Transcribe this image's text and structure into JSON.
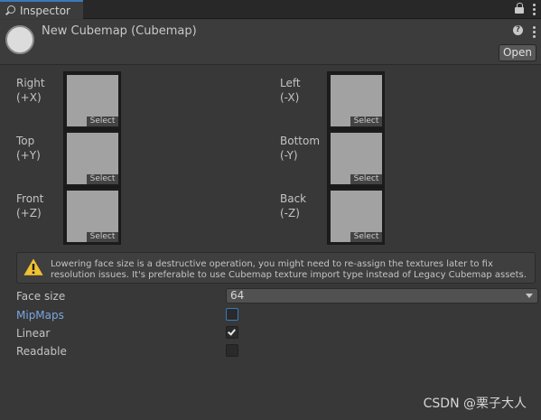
{
  "tab": {
    "label": "Inspector",
    "icon": "search-icon"
  },
  "header": {
    "title": "New Cubemap (Cubemap)",
    "open_label": "Open",
    "help_glyph": "?"
  },
  "faces": [
    {
      "name": "Right",
      "axis": "(+X)",
      "select_label": "Select"
    },
    {
      "name": "Left",
      "axis": "(-X)",
      "select_label": "Select"
    },
    {
      "name": "Top",
      "axis": "(+Y)",
      "select_label": "Select"
    },
    {
      "name": "Bottom",
      "axis": "(-Y)",
      "select_label": "Select"
    },
    {
      "name": "Front",
      "axis": "(+Z)",
      "select_label": "Select"
    },
    {
      "name": "Back",
      "axis": "(-Z)",
      "select_label": "Select"
    }
  ],
  "warning": {
    "text": "Lowering face size is a destructive operation, you might need to re-assign the textures later to fix resolution issues. It's preferable to use Cubemap texture import type instead of Legacy Cubemap assets."
  },
  "properties": {
    "face_size": {
      "label": "Face size",
      "value": "64"
    },
    "mipmaps": {
      "label": "MipMaps",
      "checked": false
    },
    "linear": {
      "label": "Linear",
      "checked": true
    },
    "readable": {
      "label": "Readable",
      "checked": false
    }
  },
  "watermark": "CSDN @栗子大人",
  "colors": {
    "accent": "#3a79bb",
    "highlight_label": "#7ba5e0",
    "background": "#383838"
  }
}
